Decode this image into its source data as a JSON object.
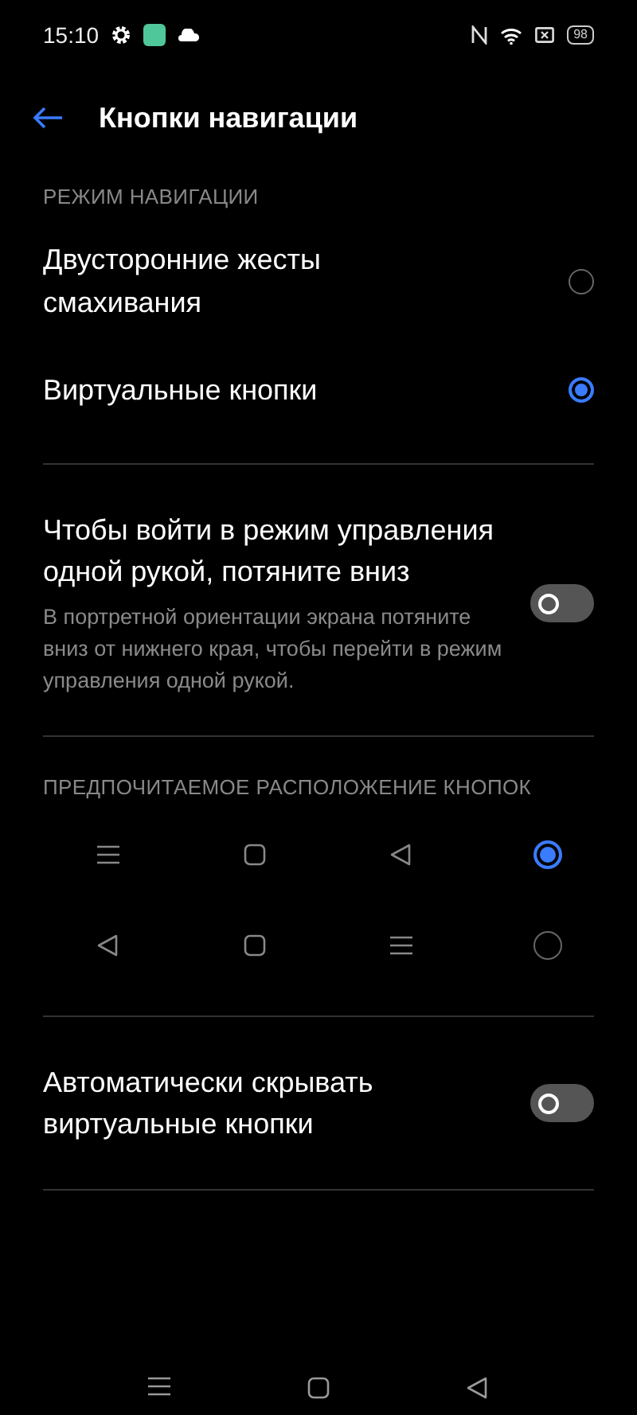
{
  "status_bar": {
    "time": "15:10",
    "battery": "98"
  },
  "header": {
    "title": "Кнопки навигации"
  },
  "navigation_mode": {
    "heading": "РЕЖИМ НАВИГАЦИИ",
    "options": [
      {
        "label": "Двусторонние жесты смахивания",
        "selected": false
      },
      {
        "label": "Виртуальные кнопки",
        "selected": true
      }
    ]
  },
  "one_hand": {
    "title": "Чтобы войти в режим управления одной рукой, потяните вниз",
    "description": "В портретной ориентации экрана потяните вниз от нижнего края, чтобы перейти в режим управления одной рукой.",
    "on": false
  },
  "button_layout": {
    "heading": "ПРЕДПОЧИТАЕМОЕ РАСПОЛОЖЕНИЕ КНОПОК",
    "options": [
      {
        "buttons": [
          {
            "kind": "menu"
          },
          {
            "kind": "home"
          },
          {
            "kind": "back"
          }
        ],
        "selected": true
      },
      {
        "buttons": [
          {
            "kind": "back"
          },
          {
            "kind": "home"
          },
          {
            "kind": "menu"
          }
        ],
        "selected": false
      }
    ]
  },
  "auto_hide": {
    "title": "Автоматически скрывать виртуальные кнопки",
    "on": false
  },
  "nav_bar": {
    "buttons": [
      {
        "kind": "menu"
      },
      {
        "kind": "home"
      },
      {
        "kind": "back"
      }
    ]
  }
}
